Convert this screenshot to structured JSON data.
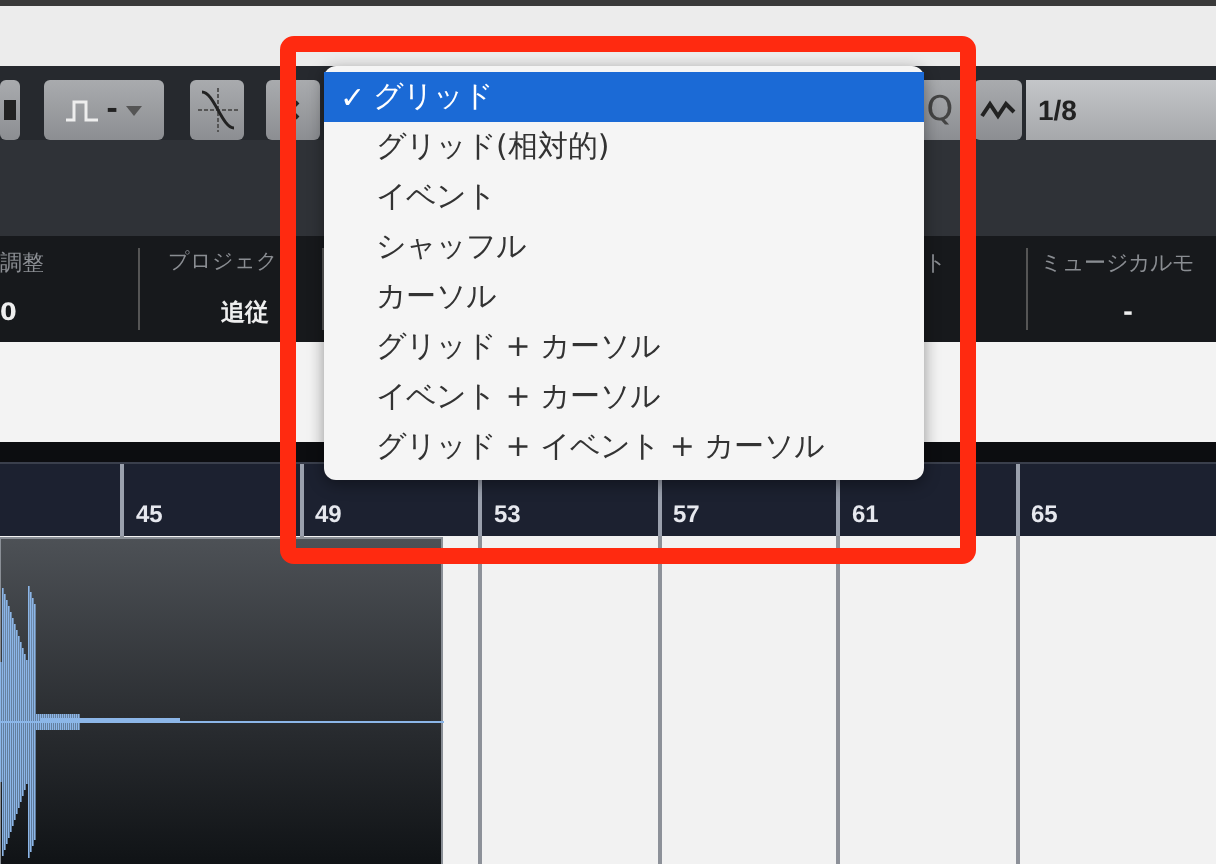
{
  "toolbar": {
    "snap_value": "-",
    "quantize_button": "Q",
    "quantize_value": "1/8"
  },
  "info_bar": [
    {
      "label": "調整",
      "value": "0"
    },
    {
      "label": "プロジェク",
      "value": "追従"
    },
    {
      "label": "ト"
    },
    {
      "label": "ミュージカルモ",
      "value": "-"
    }
  ],
  "ruler": [
    "45",
    "49",
    "53",
    "57",
    "61",
    "65"
  ],
  "snap_menu": {
    "check_mark": "✓",
    "items": [
      {
        "label": "グリッド",
        "selected": true
      },
      {
        "label": "グリッド(相対的)",
        "selected": false
      },
      {
        "label": "イベント",
        "selected": false
      },
      {
        "label": "シャッフル",
        "selected": false
      },
      {
        "label": "カーソル",
        "selected": false
      },
      {
        "label": "グリッド + カーソル",
        "selected": false
      },
      {
        "label": "イベント + カーソル",
        "selected": false
      },
      {
        "label": "グリッド + イベント + カーソル",
        "selected": false
      }
    ]
  }
}
